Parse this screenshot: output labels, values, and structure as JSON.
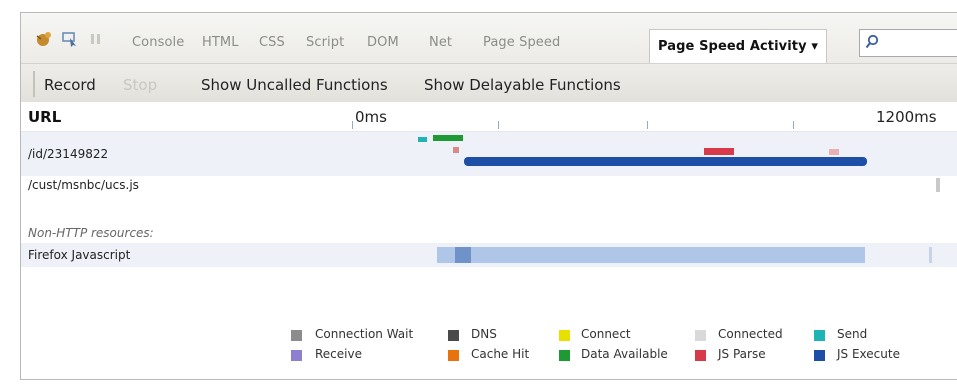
{
  "tabs": [
    "Console",
    "HTML",
    "CSS",
    "Script",
    "DOM",
    "Net",
    "Page Speed"
  ],
  "active_tab": "Page Speed Activity ▾",
  "toolbar": {
    "record": "Record",
    "stop": "Stop",
    "show_uncalled": "Show Uncalled Functions",
    "show_delayable": "Show Delayable Functions"
  },
  "timeline": {
    "url_header": "URL",
    "start_label": "0ms",
    "end_label": "1200ms",
    "rows": [
      {
        "label": "/id/23149822"
      },
      {
        "label": "/cust/msnbc/ucs.js"
      },
      {
        "label": "Non-HTTP resources:"
      },
      {
        "label": "Firefox Javascript"
      }
    ]
  },
  "legend": [
    {
      "label": "Connection Wait",
      "color": "#8c8c8c"
    },
    {
      "label": "DNS",
      "color": "#4a4a4a"
    },
    {
      "label": "Connect",
      "color": "#e8e000"
    },
    {
      "label": "Connected",
      "color": "#d9d9d9"
    },
    {
      "label": "Send",
      "color": "#1fb3b3"
    },
    {
      "label": "Receive",
      "color": "#8f7fd0"
    },
    {
      "label": "Cache Hit",
      "color": "#e8720c"
    },
    {
      "label": "Data Available",
      "color": "#1e9a34"
    },
    {
      "label": "JS Parse",
      "color": "#d83a4a"
    },
    {
      "label": "JS Execute",
      "color": "#1d4fa6"
    }
  ]
}
